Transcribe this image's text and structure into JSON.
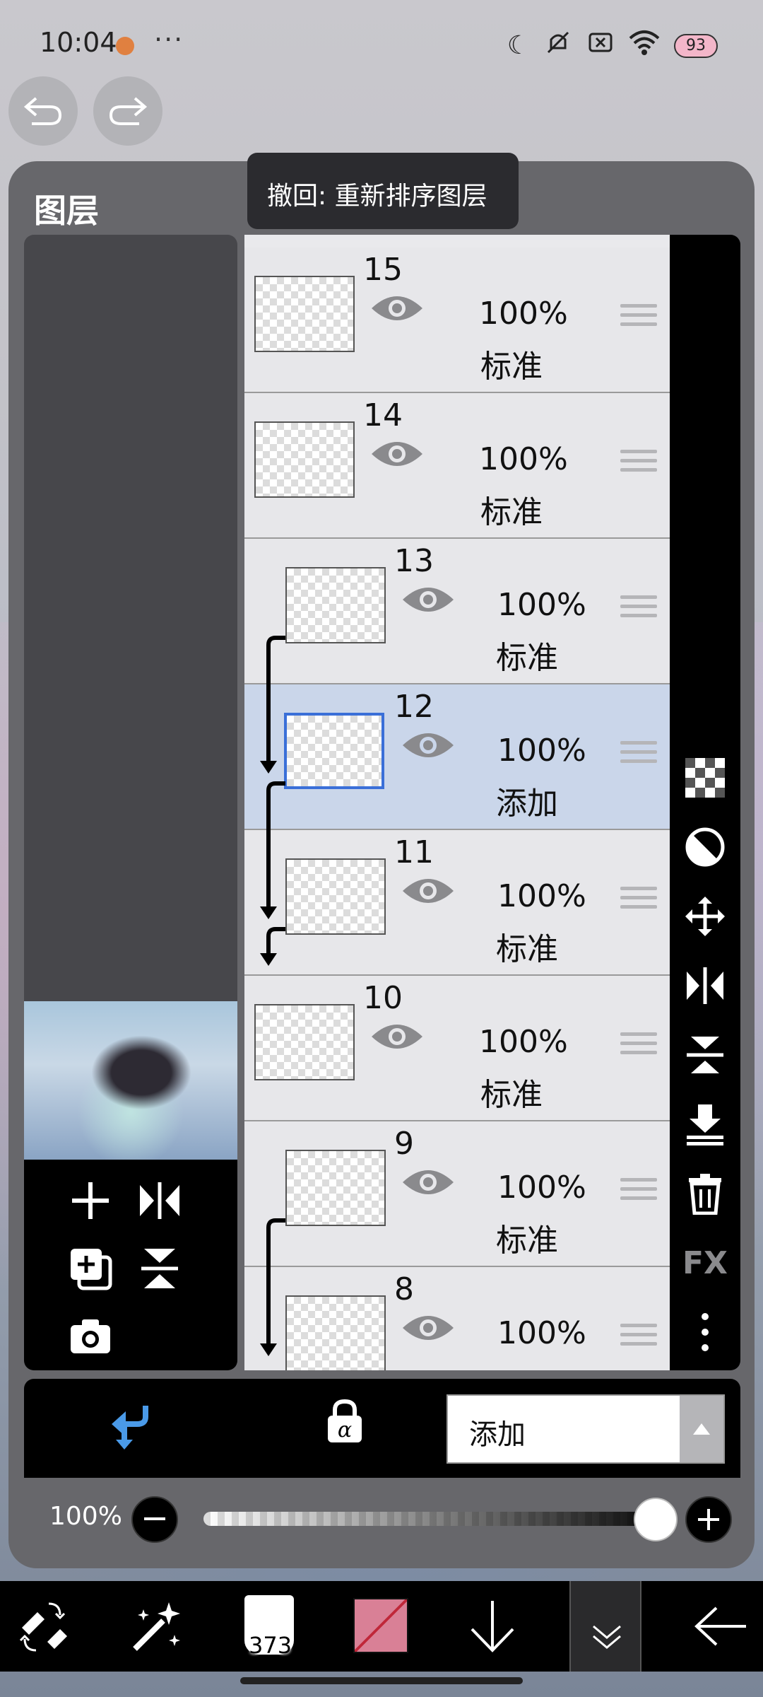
{
  "status_bar": {
    "time": "10:04",
    "more": "···",
    "battery": "93"
  },
  "tooltip": {
    "text": "撤回: 重新排序图层"
  },
  "panel": {
    "title": "图层"
  },
  "layers": [
    {
      "num": "15",
      "opacity": "100%",
      "blend": "标准"
    },
    {
      "num": "14",
      "opacity": "100%",
      "blend": "标准"
    },
    {
      "num": "13",
      "opacity": "100%",
      "blend": "标准"
    },
    {
      "num": "12",
      "opacity": "100%",
      "blend": "添加"
    },
    {
      "num": "11",
      "opacity": "100%",
      "blend": "标准"
    },
    {
      "num": "10",
      "opacity": "100%",
      "blend": "标准"
    },
    {
      "num": "9",
      "opacity": "100%",
      "blend": "标准"
    },
    {
      "num": "8",
      "opacity": "100%",
      "blend": ""
    }
  ],
  "side_tools": {
    "fx_label": "FX"
  },
  "blend_mode": {
    "current": "添加"
  },
  "opacity": {
    "label": "100%",
    "value": 1.0
  },
  "bottom_toolbar": {
    "brush_size": "373"
  },
  "colors": {
    "accent": "#3a6fd8",
    "selected_row": "#cad6ea",
    "primary_color": "#d98096"
  }
}
